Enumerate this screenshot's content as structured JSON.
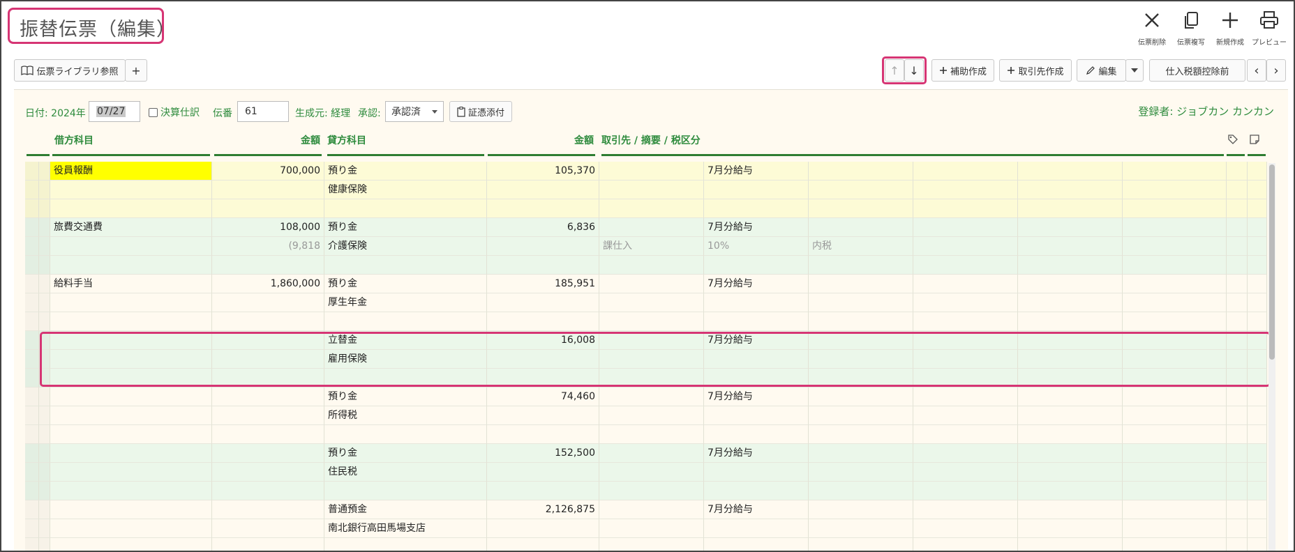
{
  "title": "振替伝票（編集）",
  "top_actions": [
    {
      "id": "delete",
      "label": "伝票削除",
      "icon": "close-icon"
    },
    {
      "id": "copy",
      "label": "伝票複写",
      "icon": "copy-icon"
    },
    {
      "id": "new",
      "label": "新規作成",
      "icon": "plus-icon"
    },
    {
      "id": "preview",
      "label": "プレビュー",
      "icon": "printer-icon"
    }
  ],
  "toolbar": {
    "library_label": "伝票ライブラリ参照",
    "add_label": "+",
    "up_arrow": "↑",
    "down_arrow": "↓",
    "aux_create_label": "補助作成",
    "partner_create_label": "取引先作成",
    "edit_label": "編集",
    "tax_label": "仕入税額控除前",
    "prev": "‹",
    "next": "›"
  },
  "form": {
    "date_label": "日付: 2024年",
    "date_value": "07/27",
    "settlement_label": "決算仕訳",
    "voucher_no_label": "伝番",
    "voucher_no_value": "61",
    "source_label": "生成元: 経理",
    "approval_label": "承認:",
    "approval_value": "承認済",
    "attach_label": "証憑添付",
    "registrant_label": "登録者: ジョブカン カンカン"
  },
  "columns": {
    "debit_account": "借方科目",
    "debit_amount": "金額",
    "credit_account": "貸方科目",
    "credit_amount": "金額",
    "partner_memo_tax": "取引先 / 摘要 / 税区分"
  },
  "entries": [
    {
      "bg": "#fdfbd6",
      "lines": [
        {
          "debit": "役員報酬",
          "debit_hl": true,
          "debit_amount": "700,000",
          "credit": "預り金",
          "credit_amount": "105,370",
          "memo": "7月分給与"
        },
        {
          "credit": "健康保険"
        },
        {}
      ]
    },
    {
      "bg": "#ebf7ea",
      "lines": [
        {
          "debit": "旅費交通費",
          "debit_amount": "108,000",
          "credit": "預り金",
          "credit_amount": "6,836",
          "memo": "7月分給与"
        },
        {
          "debit_amount": "(9,818",
          "debit_amount_gray": true,
          "credit": "介護保険",
          "tax_type": "課仕入",
          "tax_rate": "10%",
          "tax_calc": "内税"
        },
        {}
      ]
    },
    {
      "bg": "#fffaf0",
      "lines": [
        {
          "debit": "給料手当",
          "debit_amount": "1,860,000",
          "credit": "預り金",
          "credit_amount": "185,951",
          "memo": "7月分給与"
        },
        {
          "credit": "厚生年金"
        },
        {}
      ]
    },
    {
      "bg": "#ebf7ea",
      "lines": [
        {
          "credit": "立替金",
          "credit_amount": "16,008",
          "memo": "7月分給与"
        },
        {
          "credit": "雇用保険"
        },
        {}
      ]
    },
    {
      "bg": "#fffaf0",
      "lines": [
        {
          "credit": "預り金",
          "credit_amount": "74,460",
          "memo": "7月分給与"
        },
        {
          "credit": "所得税"
        },
        {}
      ]
    },
    {
      "bg": "#ebf7ea",
      "lines": [
        {
          "credit": "預り金",
          "credit_amount": "152,500",
          "memo": "7月分給与"
        },
        {
          "credit": "住民税"
        },
        {}
      ]
    },
    {
      "bg": "#fffaf0",
      "lines": [
        {
          "credit": "普通預金",
          "credit_amount": "2,126,875",
          "memo": "7月分給与"
        },
        {
          "credit": "南北銀行高田馬場支店"
        },
        {}
      ]
    }
  ]
}
